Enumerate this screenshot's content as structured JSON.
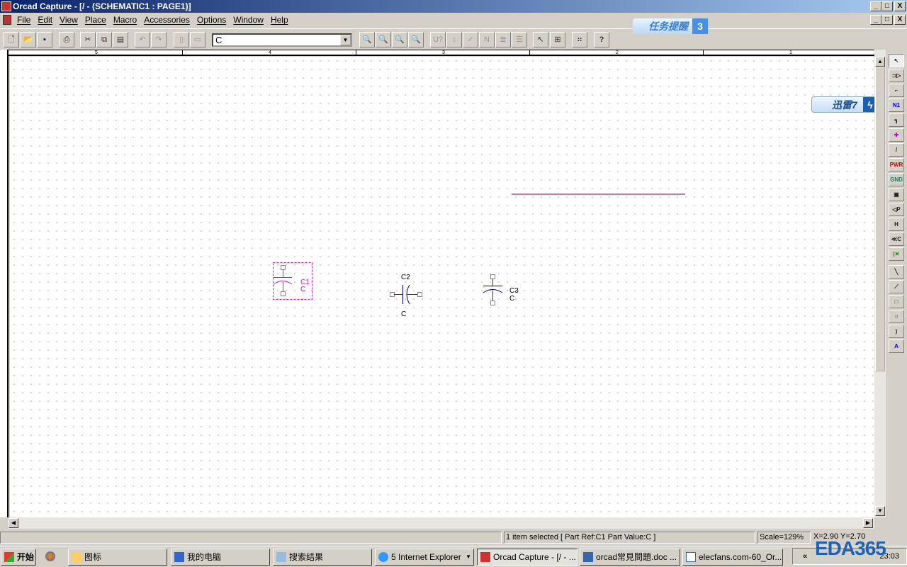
{
  "window": {
    "title": "Orcad Capture - [/ - (SCHEMATIC1 : PAGE1)]",
    "min": "_",
    "restore": "□",
    "close": "X"
  },
  "menu": [
    "File",
    "Edit",
    "View",
    "Place",
    "Macro",
    "Accessories",
    "Options",
    "Window",
    "Help"
  ],
  "toolbar": {
    "part_combo_value": "C",
    "buttons": [
      "new",
      "open",
      "save",
      "print",
      "cut",
      "copy",
      "paste",
      "undo",
      "redo",
      "view1",
      "view2",
      "zoom-in",
      "zoom-out",
      "zoom-area",
      "zoom-all",
      "annotate",
      "back-annotate",
      "drc",
      "netlist",
      "cross-ref",
      "bom",
      "snap",
      "project-manager",
      "hierarchy",
      "help"
    ]
  },
  "qq_badge": {
    "label": "任务提醒",
    "count": "3"
  },
  "xunlei_badge": {
    "label": "迅雷7",
    "glyph": "ϟ"
  },
  "ruler": {
    "top": [
      "5",
      "4",
      "3",
      "2",
      "1"
    ]
  },
  "schematic": {
    "parts": [
      {
        "ref": "C1",
        "value": "C",
        "orientation": "vertical",
        "selected": true,
        "color": "#c020c0"
      },
      {
        "ref": "C2",
        "value": "C",
        "orientation": "horizontal",
        "selected": false,
        "color": "#000080"
      },
      {
        "ref": "C3",
        "value": "C",
        "orientation": "vertical",
        "selected": false,
        "color": "#000080"
      }
    ],
    "wire_color": "#800040"
  },
  "palette": [
    {
      "icon": "select-icon",
      "glyph": "↖"
    },
    {
      "icon": "place-part-icon",
      "glyph": "⊐▷"
    },
    {
      "icon": "wire-icon",
      "glyph": "⌐"
    },
    {
      "icon": "net-alias-icon",
      "glyph": "N1"
    },
    {
      "icon": "bus-icon",
      "glyph": "┓"
    },
    {
      "icon": "junction-icon",
      "glyph": "✚"
    },
    {
      "icon": "bus-entry-icon",
      "glyph": "/"
    },
    {
      "icon": "power-icon",
      "glyph": "PWR"
    },
    {
      "icon": "ground-icon",
      "glyph": "GND"
    },
    {
      "icon": "hierarchical-block-icon",
      "glyph": "▣"
    },
    {
      "icon": "hierarchical-port-icon",
      "glyph": "◁P"
    },
    {
      "icon": "hierarchical-pin-icon",
      "glyph": "H"
    },
    {
      "icon": "off-page-connector-icon",
      "glyph": "≪C"
    },
    {
      "icon": "no-connect-icon",
      "glyph": "|✕"
    },
    {
      "icon": "line-icon",
      "glyph": "╲"
    },
    {
      "icon": "polyline-icon",
      "glyph": "⟋"
    },
    {
      "icon": "rectangle-icon",
      "glyph": "□"
    },
    {
      "icon": "ellipse-icon",
      "glyph": "○"
    },
    {
      "icon": "arc-icon",
      "glyph": ")"
    },
    {
      "icon": "text-icon",
      "glyph": "A"
    }
  ],
  "status": {
    "selection": "1 item selected [ Part Ref:C1 Part Value:C ]",
    "scale": "Scale=129%",
    "coords": "X=2.90  Y=2.70"
  },
  "taskbar": {
    "start": "开始",
    "tasks": [
      {
        "label": "图标",
        "icon": "folder-icon"
      },
      {
        "label": "我的电脑",
        "icon": "computer-icon"
      },
      {
        "label": "搜索结果",
        "icon": "search-icon"
      },
      {
        "label": "5 Internet Explorer",
        "icon": "ie-icon"
      },
      {
        "label": "Orcad Capture - [/ - ...",
        "icon": "orcad-icon",
        "active": true
      },
      {
        "label": "orcad常見問題.doc ...",
        "icon": "word-icon"
      },
      {
        "label": "elecfans.com-60_Or...",
        "icon": "doc-icon"
      }
    ],
    "clock": "23:03",
    "tray_expand": "«"
  },
  "watermark": "EDA365"
}
